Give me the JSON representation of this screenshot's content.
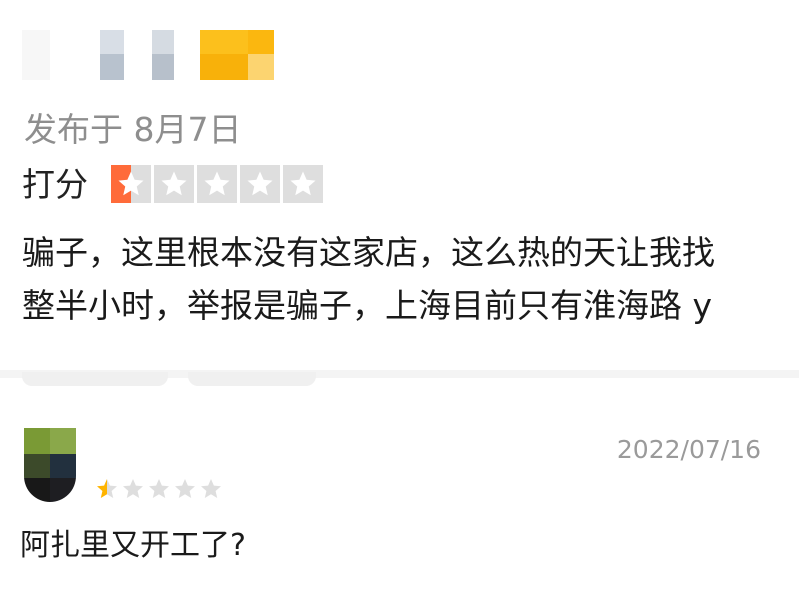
{
  "review1": {
    "published": "发布于 8月7日",
    "rating_label": "打分",
    "rating": 0.5,
    "rating_max": 5,
    "text_line1": "骗子，这里根本没有这家店，这么热的天让我找",
    "text_line2": "整半小时，举报是骗子，上海目前只有淮海路 y"
  },
  "review2": {
    "date": "2022/07/16",
    "rating": 0.5,
    "rating_max": 5,
    "text": "阿扎里又开工了?"
  },
  "colors": {
    "star_active_card": "#ff6b3a",
    "star_active_small": "#ffb400",
    "star_inactive": "#dedede"
  }
}
